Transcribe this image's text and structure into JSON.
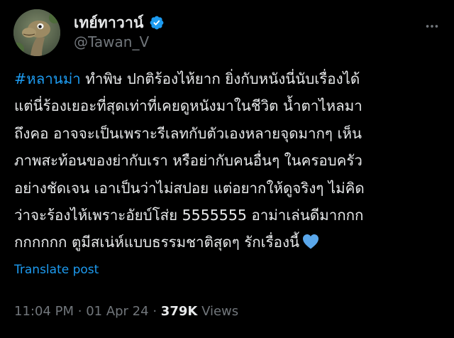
{
  "author": {
    "display_name": "เทย์ทาวาน์",
    "handle": "@Tawan_V",
    "verified": true
  },
  "tweet": {
    "lines": [
      {
        "hashtag": "#หลานม่า",
        "text": " ทำพิษ ปกติร้องไห้ยาก ยิ่งกับหนังนี่นับเรื่องได้"
      },
      {
        "text": "แต่นี่ร้องเยอะที่สุดเท่าที่เคยดูหนังมาในชีวิต น้ำตาไหลมา"
      },
      {
        "text": "ถึงคอ อาจจะเป็นเพราะรีเลทกับตัวเองหลายจุดมากๆ เห็น"
      },
      {
        "text": "ภาพสะท้อนของย่ากับเรา หรือย่ากับคนอื่นๆ ในครอบครัว"
      },
      {
        "text": "อย่างชัดเจน เอาเป็นว่าไม่สปอย แต่อยากให้ดูจริงๆ ไม่คิด"
      },
      {
        "text": "ว่าจะร้องไห้เพราะอัยบ์โส่ย 5555555 อาม่าเล่นดีมากกก"
      },
      {
        "text": "กกกกกก ตูมีสเน่ห์แบบธรรมชาติสุดๆ รักเรื่องนี้"
      }
    ],
    "trailing_emoji_icon": "blue-heart-icon",
    "translate_label": "Translate post",
    "time": "11:04 PM",
    "separator": "·",
    "date": "01 Apr 24",
    "views_count": "379K",
    "views_label": "Views"
  },
  "colors": {
    "background": "#000000",
    "text": "#e7e9ea",
    "muted": "#71767b",
    "accent": "#1d9bf0",
    "heart": "#5aa7ea"
  },
  "icons": {
    "more": "more-horizontal-icon",
    "verified": "verified-badge-icon"
  }
}
